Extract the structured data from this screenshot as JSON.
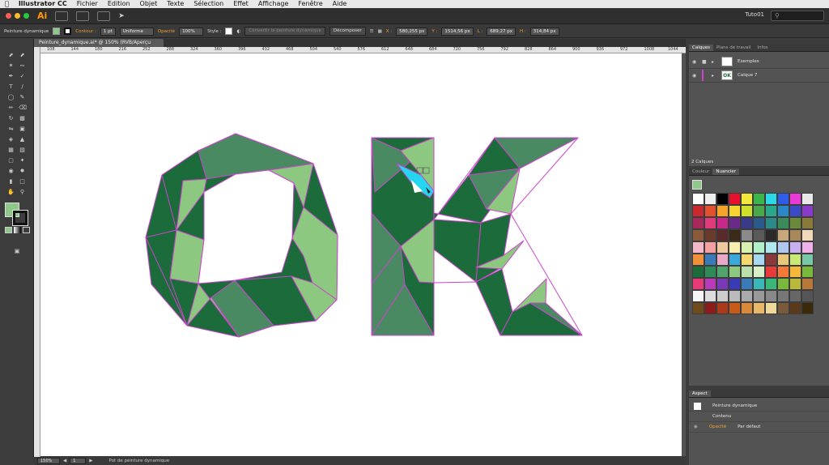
{
  "menubar": {
    "apple": "",
    "app": "Illustrator CC",
    "items": [
      "Fichier",
      "Edition",
      "Objet",
      "Texte",
      "Sélection",
      "Effet",
      "Affichage",
      "Fenêtre",
      "Aide"
    ]
  },
  "appbar": {
    "logo": "Ai",
    "workspace": "Tuto01",
    "search_placeholder": ""
  },
  "control": {
    "tool_name": "Peinture dynamique",
    "contour_label": "Contour :",
    "stroke_weight": "1 pt",
    "profile": "Uniforme",
    "opacity_label": "Opacité",
    "opacity_value": "100%",
    "style_label": "Style :",
    "convert_button": "Convertir la peinture dynamique",
    "expand_button": "Décomposer",
    "x_label": "X :",
    "x_value": "580,255 px",
    "y_label": "Y :",
    "y_value": "1514,56 px",
    "w_label": "L :",
    "w_value": "689,27 px",
    "h_label": "H :",
    "h_value": "314,84 px"
  },
  "document": {
    "tab_title": "Peinture_dynamique.ai* @ 150% (RVB/Aperçu GPU)"
  },
  "ruler": {
    "labels": [
      "108",
      "144",
      "180",
      "216",
      "252",
      "288",
      "324",
      "360",
      "396",
      "432",
      "468",
      "504",
      "540",
      "576",
      "612",
      "648",
      "684",
      "720",
      "756",
      "792",
      "828",
      "864",
      "900",
      "936",
      "972",
      "1008",
      "1044"
    ]
  },
  "status": {
    "zoom": "150%",
    "page": "1",
    "tool": "Pot de peinture dynamique"
  },
  "layers": {
    "tabs": [
      "Calques",
      "Plans de travail",
      "Infos"
    ],
    "rows": [
      {
        "name": "Exemples",
        "thumb": ""
      },
      {
        "name": "Calque 7",
        "thumb": "OK"
      }
    ],
    "count": "2 Calques"
  },
  "swatches": {
    "tabs": [
      "Couleur",
      "Nuancier"
    ],
    "colors": [
      "#ffffff",
      "#eeeeee",
      "#000000",
      "#e8112d",
      "#f5e83a",
      "#3ab54a",
      "#2bd8e8",
      "#2f5ce8",
      "#e93ad8",
      "#e9e9e9",
      "#c8282e",
      "#e2502d",
      "#f5a32a",
      "#f7d430",
      "#cfe02c",
      "#4aa84a",
      "#2aa88a",
      "#2a88c8",
      "#3a4ac8",
      "#8a3ac8",
      "#a8285a",
      "#e03a78",
      "#c8288a",
      "#6a2a8a",
      "#3a3a8a",
      "#2a5a8a",
      "#2a8a8a",
      "#3a8a5a",
      "#6a8a3a",
      "#8a7a3a",
      "#8a5a3a",
      "#6a3a2a",
      "#5a2a2a",
      "#3a2a1a",
      "#8a8a8a",
      "#5a5a5a",
      "#2a2a2a",
      "#c8a87a",
      "#a8885a",
      "#f0d8b8",
      "#f5b8c8",
      "#f5a0a0",
      "#f0c8a0",
      "#f5f0b0",
      "#d8f0b0",
      "#b0f0c8",
      "#b0e8f0",
      "#b0c8f0",
      "#c8b0f0",
      "#f0b0e8",
      "#f09038",
      "#3a7ab8",
      "#e8a8c8",
      "#3aa8d8",
      "#f5d870",
      "#a8d8f0",
      "#8a3a3a",
      "#e8c878",
      "#c8e878",
      "#78c8a8",
      "#1c6b3a",
      "#2e8b57",
      "#4fa36b",
      "#8cc880",
      "#b8e0a8",
      "#d8f0c8",
      "#e83a3a",
      "#f57a3a",
      "#f5b83a",
      "#78b83a",
      "#e83a78",
      "#b83ab8",
      "#7a3ab8",
      "#3a3ab8",
      "#3a7ab8",
      "#3ab8b8",
      "#3ab878",
      "#78b83a",
      "#b8b83a",
      "#b8783a",
      "#f5f5f5",
      "#dddddd",
      "#cccccc",
      "#bbbbbb",
      "#aaaaaa",
      "#999999",
      "#888888",
      "#777777",
      "#666666",
      "#555555",
      "#6f4a1a",
      "#8c1c1c",
      "#aa3a1a",
      "#c85a1a",
      "#d88a3a",
      "#e8b86a",
      "#f0d89a",
      "#7a5a3a",
      "#5a3a1a",
      "#3a2a0a"
    ]
  },
  "aspect": {
    "title": "Aspect",
    "object": "Peinture dynamique",
    "content": "Contenu",
    "opacity_label": "Opacité",
    "opacity_value": "Par défaut"
  },
  "colors": {
    "accent_green": "#1c6b3a",
    "mid_green": "#4a8a62",
    "light_green": "#8cc880",
    "highlight_cyan": "#25d6f0",
    "edge_purple": "#cc44cc"
  }
}
